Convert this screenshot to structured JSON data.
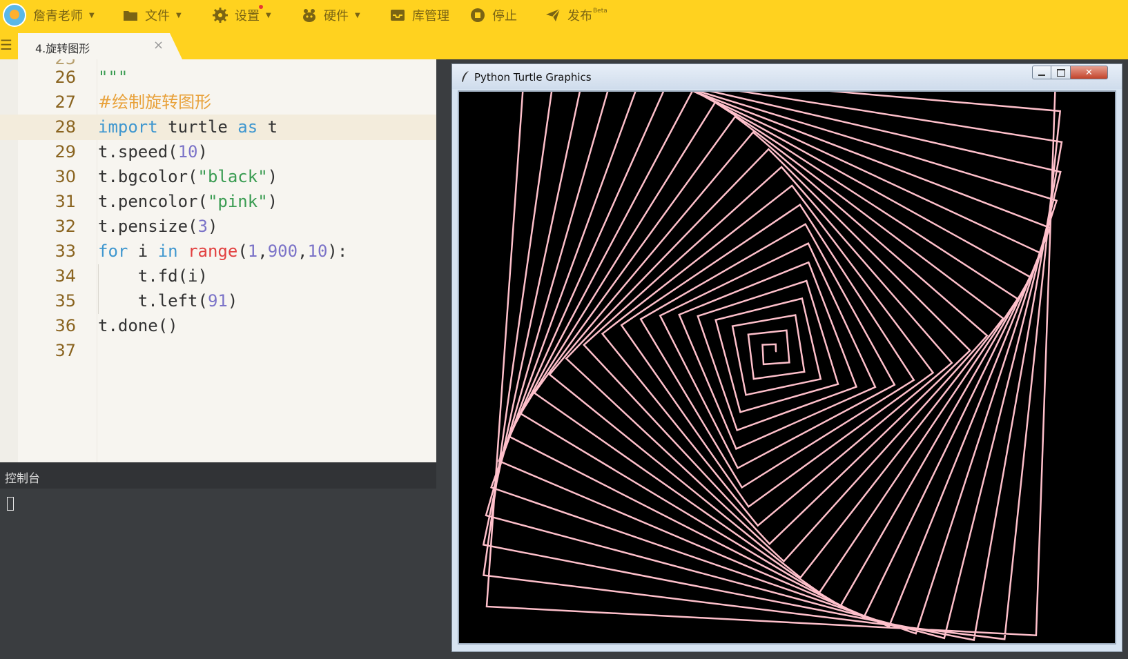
{
  "toolbar": {
    "user_name": "詹青老师",
    "file_label": "文件",
    "settings_label": "设置",
    "hardware_label": "硬件",
    "library_label": "库管理",
    "stop_label": "停止",
    "publish_label": "发布",
    "publish_badge": "Beta",
    "accent_color": "#ffd21f"
  },
  "tab": {
    "label": "4.旋转图形",
    "close_glyph": "×"
  },
  "editor": {
    "lines": [
      {
        "number": "26",
        "text": "\"\"\""
      },
      {
        "number": "27",
        "text": "#绘制旋转图形"
      },
      {
        "number": "28",
        "text": "import turtle as t"
      },
      {
        "number": "29",
        "text": "t.speed(10)"
      },
      {
        "number": "30",
        "text": "t.bgcolor(\"black\")"
      },
      {
        "number": "31",
        "text": "t.pencolor(\"pink\")"
      },
      {
        "number": "32",
        "text": "t.pensize(3)"
      },
      {
        "number": "33",
        "text": "for i in range(1,900,10):"
      },
      {
        "number": "34",
        "text": "    t.fd(i)"
      },
      {
        "number": "35",
        "text": "    t.left(91)"
      },
      {
        "number": "36",
        "text": "t.done()"
      },
      {
        "number": "37",
        "text": ""
      }
    ],
    "current_line": "28"
  },
  "console": {
    "title": "控制台"
  },
  "turtle_window": {
    "title": "Python Turtle Graphics",
    "close_glyph": "✕",
    "drawing": {
      "range_start": 1,
      "range_stop": 900,
      "range_step": 10,
      "turn_angle": 91,
      "pen_color": "#ffc0cb",
      "background_color": "#000000",
      "pen_size": 3
    }
  }
}
